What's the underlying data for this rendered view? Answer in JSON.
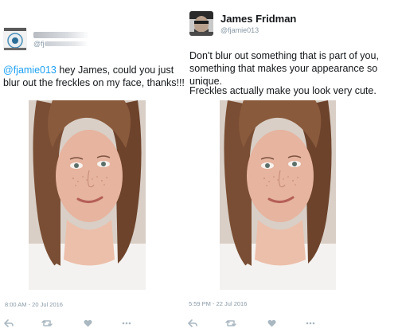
{
  "left_tweet": {
    "handle_visible": "@fj",
    "mention": "@fjamie013",
    "text": " hey James, could you just blur out the freckles on my face, thanks!!!",
    "timestamp": "8:00 AM - 20 Jul 2016"
  },
  "right_tweet": {
    "name": "James Fridman",
    "handle": "@fjamie013",
    "paragraph1": "Don't blur out something that is part of you, something that makes your appearance so unique.",
    "paragraph2": "Freckles actually make you look very cute.",
    "timestamp": "5:59 PM - 22 Jul 2016"
  },
  "actions": {
    "reply_icon": "reply-icon",
    "retweet_icon": "retweet-icon",
    "like_icon": "heart-icon",
    "more_icon": "more-icon"
  },
  "colors": {
    "link": "#1da1f2",
    "meta": "#8899a6",
    "icon": "#aab8c2"
  }
}
